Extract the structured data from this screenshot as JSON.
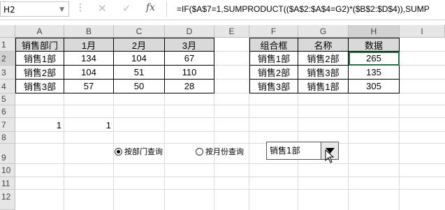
{
  "formula_bar": {
    "name_box": "H2",
    "cancel_icon": "✕",
    "enter_icon": "✓",
    "fx_label": "fx",
    "formula": "=IF($A$7=1,SUMPRODUCT(($A$2:$A$4=G2)*($B$2:$D$4)),SUMP"
  },
  "columns": [
    "A",
    "B",
    "C",
    "D",
    "E",
    "F",
    "G",
    "H",
    "I"
  ],
  "rows": [
    "1",
    "2",
    "3",
    "4",
    "5",
    "6",
    "7",
    "8",
    "9",
    "10",
    "11",
    "12"
  ],
  "table1": {
    "headers": [
      "销售部门",
      "1月",
      "2月",
      "3月"
    ],
    "rows": [
      [
        "销售1部",
        "134",
        "104",
        "67"
      ],
      [
        "销售2部",
        "104",
        "51",
        "110"
      ],
      [
        "销售3部",
        "57",
        "50",
        "28"
      ]
    ]
  },
  "table2": {
    "headers": [
      "组合框",
      "名称",
      "数据"
    ],
    "rows": [
      [
        "销售1部",
        "销售2部",
        "265"
      ],
      [
        "销售2部",
        "销售3部",
        "135"
      ],
      [
        "销售3部",
        "销售1部",
        "305"
      ]
    ]
  },
  "cells": {
    "A7": "1",
    "B7": "1"
  },
  "controls": {
    "radio_department": {
      "label": "按部门查询",
      "checked": true
    },
    "radio_month": {
      "label": "按月份查询",
      "checked": false
    },
    "combo_value": "销售1部"
  }
}
